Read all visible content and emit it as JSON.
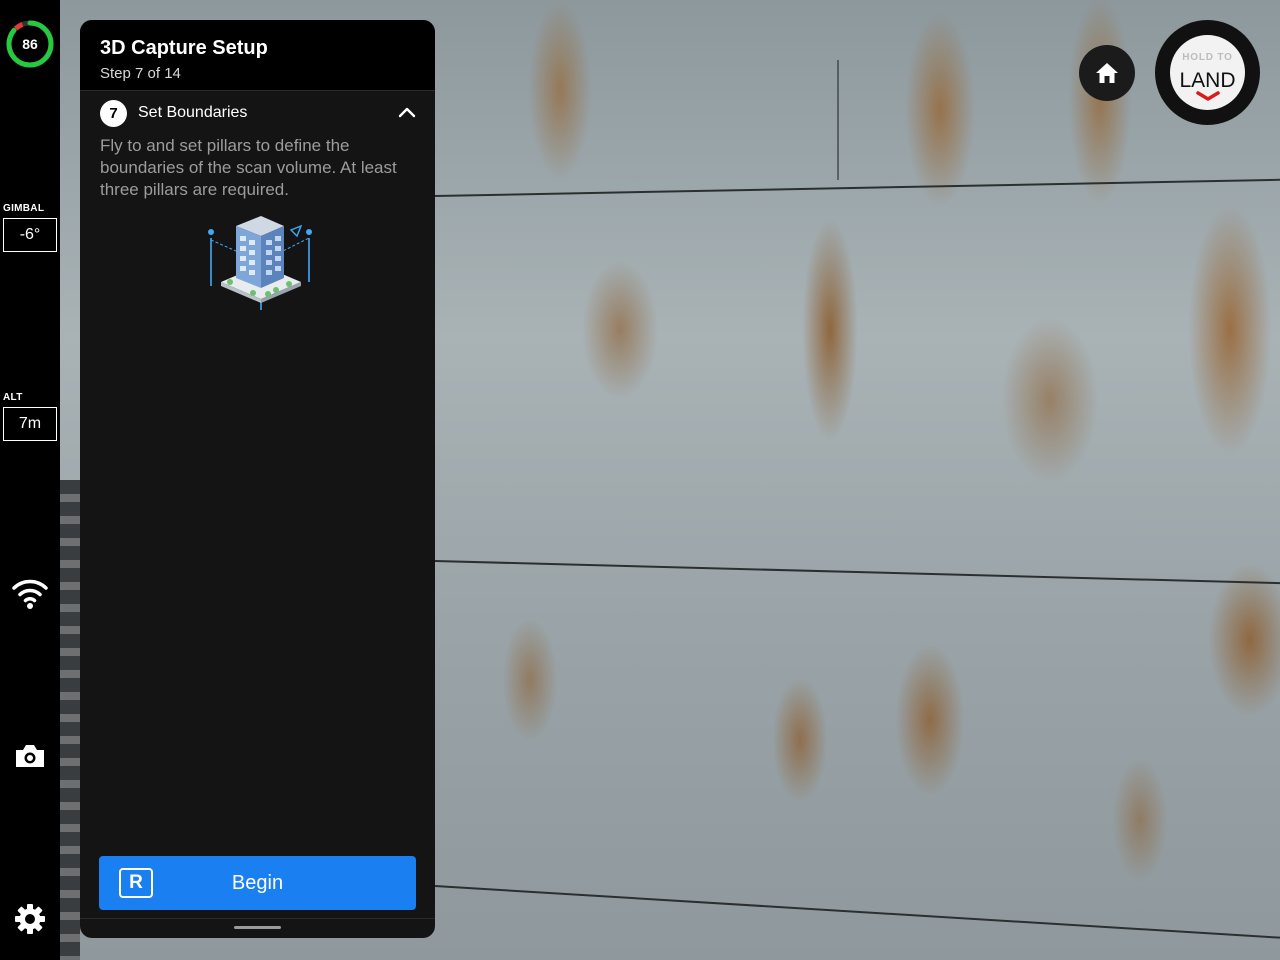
{
  "battery": {
    "value": "86",
    "level_percent": 86,
    "ring_color": "#27c93f",
    "warning_color": "#e53935"
  },
  "gimbal": {
    "label": "GIMBAL",
    "value": "-6°"
  },
  "altitude": {
    "label": "ALT",
    "value": "7m"
  },
  "sidebar_icons": {
    "connection": "wifi-icon",
    "camera": "camera-icon",
    "settings": "gear-icon"
  },
  "panel": {
    "title": "3D Capture Setup",
    "step": "Step 7 of 14",
    "current_step": {
      "number": "7",
      "title": "Set Boundaries",
      "description": "Fly to and set pillars to define the boundaries of the scan volume. At least three pillars are required."
    },
    "begin_button": {
      "key_hint": "R",
      "label": "Begin"
    }
  },
  "controls": {
    "home_icon": "home-icon",
    "land_button": {
      "hold_label": "HOLD TO",
      "action_label": "LAND"
    }
  },
  "colors": {
    "accent": "#1a7ff0",
    "panel_bg": "#141414",
    "land_mark": "#d81b1b"
  }
}
